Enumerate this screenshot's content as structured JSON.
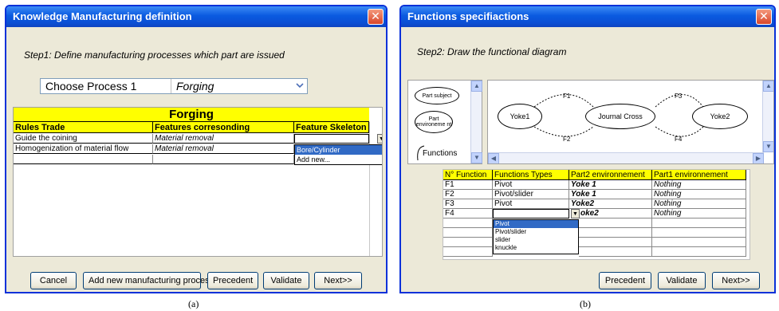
{
  "windowA": {
    "title": "Knowledge Manufacturing definition",
    "close": "✕",
    "step": "Step1: Define manufacturing processes which part are issued",
    "process_label": "Choose Process 1",
    "process_value": "Forging",
    "table": {
      "banner": "Forging",
      "headers": [
        "Rules Trade",
        "Features corresonding",
        "Feature Skeleton"
      ],
      "rows": [
        [
          "Guide the coining",
          "Material removal",
          ""
        ],
        [
          "Homogenization of material flow",
          "Material removal",
          ""
        ]
      ],
      "dropdown_options": [
        "Bore/Cylinder",
        "Add new..."
      ]
    },
    "buttons": {
      "cancel": "Cancel",
      "add": "Add new manufacturing process",
      "precedent": "Precedent",
      "validate": "Validate",
      "next": "Next>>"
    }
  },
  "windowB": {
    "title": "Functions specifiactions",
    "close": "✕",
    "step": "Step2: Draw the functional diagram",
    "palette": {
      "part_subject": "Part subject",
      "part_env": "Part environeme nt",
      "functions": "Functions"
    },
    "diagram": {
      "nodes": [
        "Yoke1",
        "Journal Cross",
        "Yoke2"
      ],
      "links": [
        "F1",
        "F2",
        "F3",
        "F4"
      ]
    },
    "table": {
      "headers": [
        "N° Function",
        "Functions Types",
        "Part2 environnement",
        "Part1 environnement"
      ],
      "rows": [
        [
          "F1",
          "Pivot",
          "Yoke 1",
          "Nothing"
        ],
        [
          "F2",
          "Pivot/slider",
          "Yoke 1",
          "Nothing"
        ],
        [
          "F3",
          "Pivot",
          "Yoke2",
          "Nothing"
        ],
        [
          "F4",
          "",
          "oke2",
          "Nothing"
        ]
      ],
      "dropdown_options": [
        "Pivot",
        "Pivot/slider",
        "slider",
        "knuckle"
      ]
    },
    "buttons": {
      "precedent": "Precedent",
      "validate": "Validate",
      "next": "Next>>"
    }
  },
  "captions": {
    "a": "(a)",
    "b": "(b)"
  },
  "colors": {
    "title_bar": "#0a5ae0",
    "header_fill": "#ffff00",
    "selection": "#316ac5"
  }
}
